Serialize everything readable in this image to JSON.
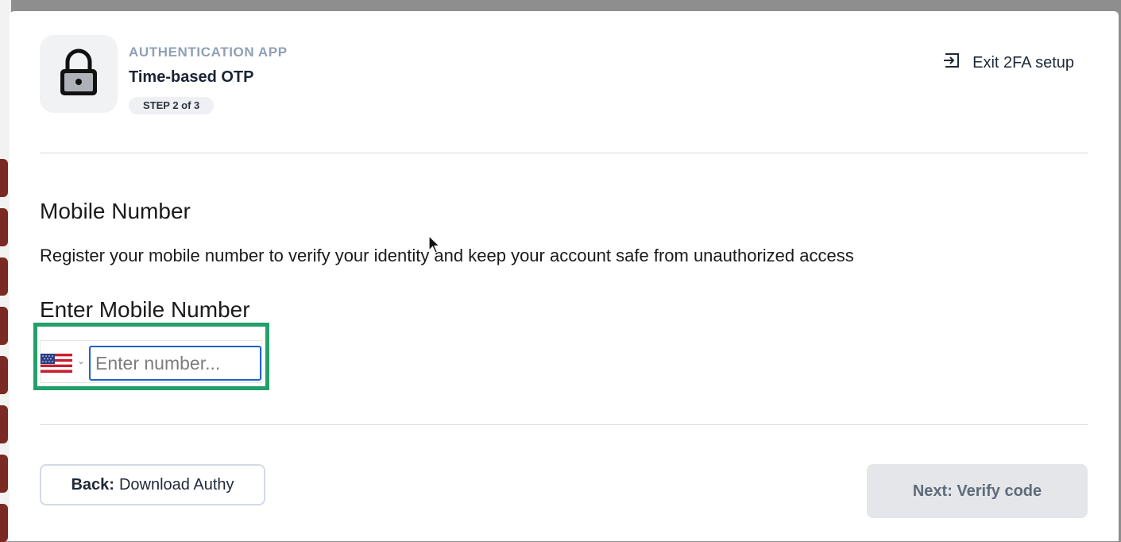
{
  "header": {
    "eyebrow": "AUTHENTICATION APP",
    "title": "Time-based OTP",
    "step": "STEP 2 of 3",
    "icon": "lock-icon",
    "exit_label": "Exit 2FA setup",
    "exit_icon": "exit-icon"
  },
  "main": {
    "section_title": "Mobile Number",
    "section_description": "Register your mobile number to verify your identity and keep your account safe from unauthorized access",
    "field_label": "Enter Mobile Number",
    "phone": {
      "country_flag": "us-flag-icon",
      "placeholder": "Enter number...",
      "value": ""
    }
  },
  "footer": {
    "back_prefix": "Back:",
    "back_label": "Download Authy",
    "next_label": "Next: Verify code"
  },
  "colors": {
    "highlight": "#23a06a",
    "input_focus": "#1f62c9",
    "eyebrow": "#8fa0b6"
  }
}
